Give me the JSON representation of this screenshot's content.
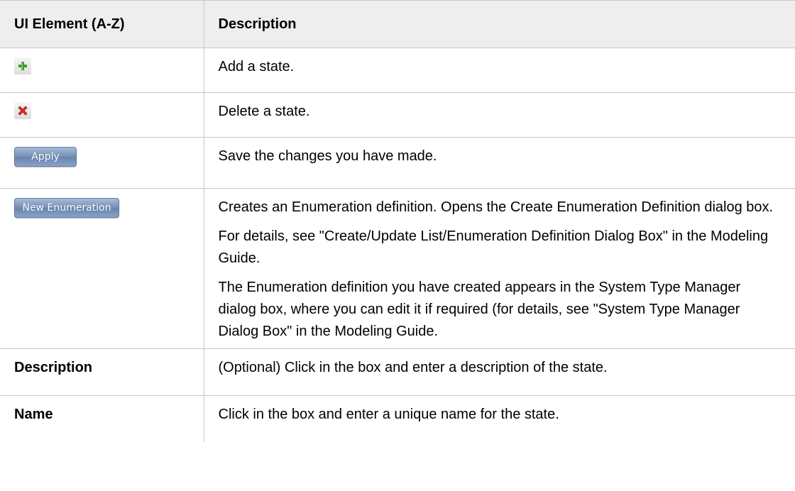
{
  "table": {
    "headers": [
      "UI Element (A-Z)",
      "Description"
    ],
    "rows": [
      {
        "element_icon": "add-icon",
        "description": "Add a state."
      },
      {
        "element_icon": "delete-icon",
        "description": "Delete a state."
      },
      {
        "element_button": "Apply",
        "description": "Save the changes you have made."
      },
      {
        "element_button": "New Enumeration",
        "paragraphs": [
          "Creates an Enumeration definition. Opens the Create Enumeration Definition dialog box.",
          "For details, see \"Create/Update List/Enumeration Definition Dialog Box\" in the Modeling Guide.",
          "The Enumeration definition you have created appears in the System Type Manager dialog box, where you can edit it if required (for details, see \"System Type Manager Dialog Box\" in the Modeling Guide."
        ]
      },
      {
        "element_label": "Description",
        "description": "(Optional) Click in the box and enter a description of the state."
      },
      {
        "element_label": "Name",
        "description": "Click in the box and enter a unique name for the state."
      }
    ]
  },
  "colors": {
    "header_bg": "#eeeeee",
    "border": "#c8c8c8",
    "add_icon": "#3c9a2e",
    "delete_icon": "#d9301f",
    "button_blue": "#7893b9"
  }
}
